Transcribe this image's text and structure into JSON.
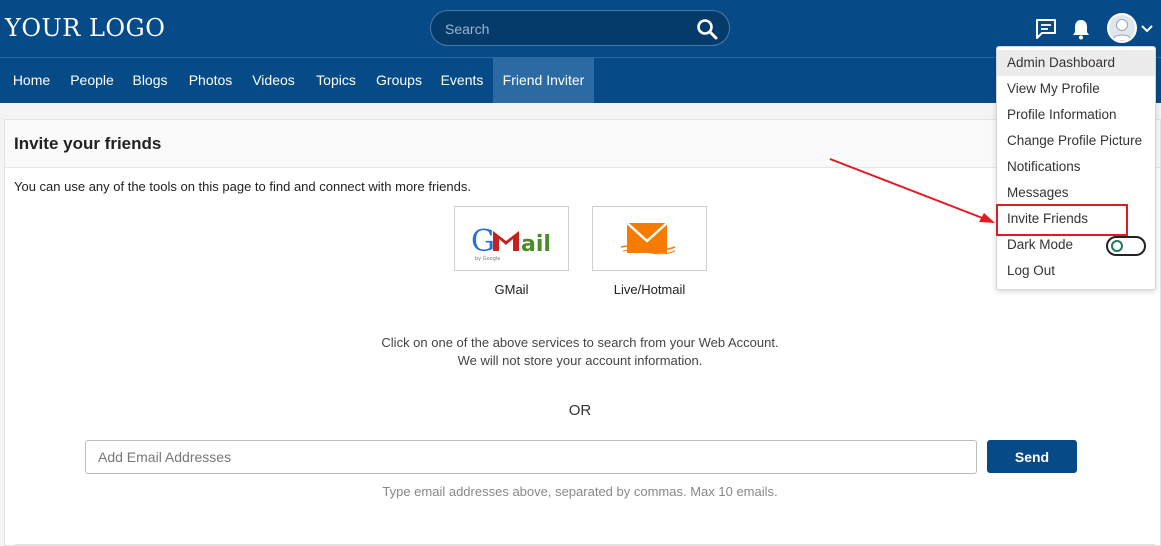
{
  "header": {
    "logo": "YOUR LOGO",
    "search_placeholder": "Search",
    "icons": [
      "search-icon",
      "chat-icon",
      "bell-icon",
      "avatar",
      "chevron-down-icon"
    ]
  },
  "nav": {
    "items": [
      "Home",
      "People",
      "Blogs",
      "Photos",
      "Videos",
      "Topics",
      "Groups",
      "Events",
      "Friend Inviter"
    ],
    "active": "Friend Inviter"
  },
  "card": {
    "title": "Invite your friends",
    "intro": "You can use any of the tools on this page to find and connect with more friends.",
    "providers": [
      {
        "label": "GMail",
        "logo_text": "GMail",
        "logo_subtext": "by Google"
      },
      {
        "label": "Live/Hotmail"
      }
    ],
    "note_line1": "Click on one of the above services to search from your Web Account.",
    "note_line2": "We will not store your account information.",
    "or": "OR",
    "email_placeholder": "Add Email Addresses",
    "send_label": "Send",
    "hint": "Type email addresses above, separated by commas. Max 10 emails."
  },
  "dropdown": {
    "items": [
      "Admin Dashboard",
      "View My Profile",
      "Profile Information",
      "Change Profile Picture",
      "Notifications",
      "Messages",
      "Invite Friends",
      "Dark Mode",
      "Log Out"
    ],
    "hovered": "Admin Dashboard",
    "highlighted": "Invite Friends",
    "dark_mode_on": false
  },
  "colors": {
    "brand": "#064b87",
    "nav_active": "#2b6aa3",
    "highlight": "#e01b24",
    "gmail_red": "#c5221f",
    "hotmail_orange": "#f57c00"
  }
}
